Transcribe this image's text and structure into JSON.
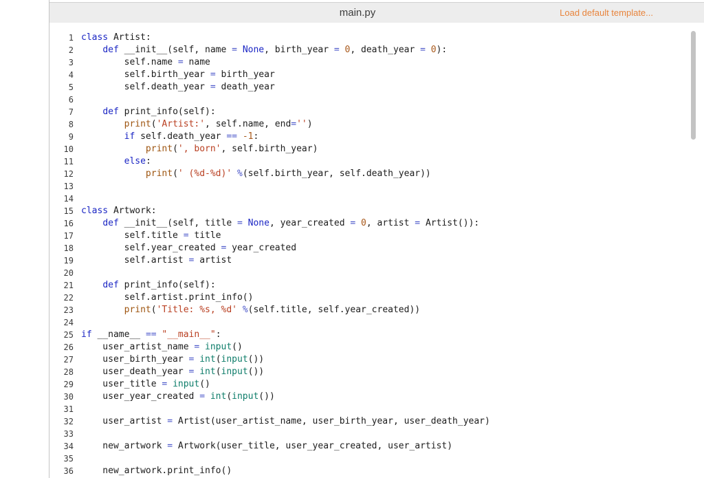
{
  "colors": {
    "accent": "#e8843c",
    "topbar_bg": "#ededed",
    "topbar_border": "#d2d2d2",
    "panel_border": "#c4c4c4",
    "filename": "#3c3c3c",
    "linenum": "#3a3a3a",
    "scrollbar": "#c3c3c3"
  },
  "header": {
    "filename": "main.py",
    "load_template_label": "Load default template..."
  },
  "editor": {
    "syntax_colors": {
      "kw": "#1b26c4",
      "atom": "#1b26c4",
      "op": "#4955c9",
      "num": "#a8581a",
      "str": "#b93f21",
      "builtin": "#9e5510",
      "func": "#0e7d6a",
      "plain": "#1c1c1c"
    },
    "lines": [
      {
        "num": 1,
        "tokens": [
          [
            "kw",
            "class"
          ],
          [
            "plain",
            " Artist:"
          ]
        ]
      },
      {
        "num": 2,
        "tokens": [
          [
            "plain",
            "    "
          ],
          [
            "kw",
            "def"
          ],
          [
            "plain",
            " __init__(self, name "
          ],
          [
            "op",
            "="
          ],
          [
            "plain",
            " "
          ],
          [
            "atom",
            "None"
          ],
          [
            "plain",
            ", birth_year "
          ],
          [
            "op",
            "="
          ],
          [
            "plain",
            " "
          ],
          [
            "num",
            "0"
          ],
          [
            "plain",
            ", death_year "
          ],
          [
            "op",
            "="
          ],
          [
            "plain",
            " "
          ],
          [
            "num",
            "0"
          ],
          [
            "plain",
            "):"
          ]
        ]
      },
      {
        "num": 3,
        "tokens": [
          [
            "plain",
            "        self.name "
          ],
          [
            "op",
            "="
          ],
          [
            "plain",
            " name"
          ]
        ]
      },
      {
        "num": 4,
        "tokens": [
          [
            "plain",
            "        self.birth_year "
          ],
          [
            "op",
            "="
          ],
          [
            "plain",
            " birth_year"
          ]
        ]
      },
      {
        "num": 5,
        "tokens": [
          [
            "plain",
            "        self.death_year "
          ],
          [
            "op",
            "="
          ],
          [
            "plain",
            " death_year"
          ]
        ]
      },
      {
        "num": 6,
        "tokens": []
      },
      {
        "num": 7,
        "tokens": [
          [
            "plain",
            "    "
          ],
          [
            "kw",
            "def"
          ],
          [
            "plain",
            " print_info(self):"
          ]
        ]
      },
      {
        "num": 8,
        "tokens": [
          [
            "plain",
            "        "
          ],
          [
            "builtin",
            "print"
          ],
          [
            "plain",
            "("
          ],
          [
            "str",
            "'Artist:'"
          ],
          [
            "plain",
            ", self.name, end"
          ],
          [
            "op",
            "="
          ],
          [
            "str",
            "''"
          ],
          [
            "plain",
            ")"
          ]
        ]
      },
      {
        "num": 9,
        "tokens": [
          [
            "plain",
            "        "
          ],
          [
            "kw",
            "if"
          ],
          [
            "plain",
            " self.death_year "
          ],
          [
            "op",
            "=="
          ],
          [
            "plain",
            " "
          ],
          [
            "num",
            "-1"
          ],
          [
            "plain",
            ":"
          ]
        ]
      },
      {
        "num": 10,
        "tokens": [
          [
            "plain",
            "            "
          ],
          [
            "builtin",
            "print"
          ],
          [
            "plain",
            "("
          ],
          [
            "str",
            "', born'"
          ],
          [
            "plain",
            ", self.birth_year)"
          ]
        ]
      },
      {
        "num": 11,
        "tokens": [
          [
            "plain",
            "        "
          ],
          [
            "kw",
            "else"
          ],
          [
            "plain",
            ":"
          ]
        ]
      },
      {
        "num": 12,
        "tokens": [
          [
            "plain",
            "            "
          ],
          [
            "builtin",
            "print"
          ],
          [
            "plain",
            "("
          ],
          [
            "str",
            "' (%d-%d)'"
          ],
          [
            "plain",
            " "
          ],
          [
            "op",
            "%"
          ],
          [
            "plain",
            "(self.birth_year, self.death_year))"
          ]
        ]
      },
      {
        "num": 13,
        "tokens": []
      },
      {
        "num": 14,
        "tokens": []
      },
      {
        "num": 15,
        "tokens": [
          [
            "kw",
            "class"
          ],
          [
            "plain",
            " Artwork:"
          ]
        ]
      },
      {
        "num": 16,
        "tokens": [
          [
            "plain",
            "    "
          ],
          [
            "kw",
            "def"
          ],
          [
            "plain",
            " __init__(self, title "
          ],
          [
            "op",
            "="
          ],
          [
            "plain",
            " "
          ],
          [
            "atom",
            "None"
          ],
          [
            "plain",
            ", year_created "
          ],
          [
            "op",
            "="
          ],
          [
            "plain",
            " "
          ],
          [
            "num",
            "0"
          ],
          [
            "plain",
            ", artist "
          ],
          [
            "op",
            "="
          ],
          [
            "plain",
            " Artist()):"
          ]
        ]
      },
      {
        "num": 17,
        "tokens": [
          [
            "plain",
            "        self.title "
          ],
          [
            "op",
            "="
          ],
          [
            "plain",
            " title"
          ]
        ]
      },
      {
        "num": 18,
        "tokens": [
          [
            "plain",
            "        self.year_created "
          ],
          [
            "op",
            "="
          ],
          [
            "plain",
            " year_created"
          ]
        ]
      },
      {
        "num": 19,
        "tokens": [
          [
            "plain",
            "        self.artist "
          ],
          [
            "op",
            "="
          ],
          [
            "plain",
            " artist"
          ]
        ]
      },
      {
        "num": 20,
        "tokens": []
      },
      {
        "num": 21,
        "tokens": [
          [
            "plain",
            "    "
          ],
          [
            "kw",
            "def"
          ],
          [
            "plain",
            " print_info(self):"
          ]
        ]
      },
      {
        "num": 22,
        "tokens": [
          [
            "plain",
            "        self.artist.print_info()"
          ]
        ]
      },
      {
        "num": 23,
        "tokens": [
          [
            "plain",
            "        "
          ],
          [
            "builtin",
            "print"
          ],
          [
            "plain",
            "("
          ],
          [
            "str",
            "'Title: %s, %d'"
          ],
          [
            "plain",
            " "
          ],
          [
            "op",
            "%"
          ],
          [
            "plain",
            "(self.title, self.year_created))"
          ]
        ]
      },
      {
        "num": 24,
        "tokens": []
      },
      {
        "num": 25,
        "tokens": [
          [
            "kw",
            "if"
          ],
          [
            "plain",
            " __name__ "
          ],
          [
            "op",
            "=="
          ],
          [
            "plain",
            " "
          ],
          [
            "str",
            "\"__main__\""
          ],
          [
            "plain",
            ":"
          ]
        ]
      },
      {
        "num": 26,
        "tokens": [
          [
            "plain",
            "    user_artist_name "
          ],
          [
            "op",
            "="
          ],
          [
            "plain",
            " "
          ],
          [
            "func",
            "input"
          ],
          [
            "plain",
            "()"
          ]
        ]
      },
      {
        "num": 27,
        "tokens": [
          [
            "plain",
            "    user_birth_year "
          ],
          [
            "op",
            "="
          ],
          [
            "plain",
            " "
          ],
          [
            "func",
            "int"
          ],
          [
            "plain",
            "("
          ],
          [
            "func",
            "input"
          ],
          [
            "plain",
            "())"
          ]
        ]
      },
      {
        "num": 28,
        "tokens": [
          [
            "plain",
            "    user_death_year "
          ],
          [
            "op",
            "="
          ],
          [
            "plain",
            " "
          ],
          [
            "func",
            "int"
          ],
          [
            "plain",
            "("
          ],
          [
            "func",
            "input"
          ],
          [
            "plain",
            "())"
          ]
        ]
      },
      {
        "num": 29,
        "tokens": [
          [
            "plain",
            "    user_title "
          ],
          [
            "op",
            "="
          ],
          [
            "plain",
            " "
          ],
          [
            "func",
            "input"
          ],
          [
            "plain",
            "()"
          ]
        ]
      },
      {
        "num": 30,
        "tokens": [
          [
            "plain",
            "    user_year_created "
          ],
          [
            "op",
            "="
          ],
          [
            "plain",
            " "
          ],
          [
            "func",
            "int"
          ],
          [
            "plain",
            "("
          ],
          [
            "func",
            "input"
          ],
          [
            "plain",
            "())"
          ]
        ]
      },
      {
        "num": 31,
        "tokens": []
      },
      {
        "num": 32,
        "tokens": [
          [
            "plain",
            "    user_artist "
          ],
          [
            "op",
            "="
          ],
          [
            "plain",
            " Artist(user_artist_name, user_birth_year, user_death_year)"
          ]
        ]
      },
      {
        "num": 33,
        "tokens": []
      },
      {
        "num": 34,
        "tokens": [
          [
            "plain",
            "    new_artwork "
          ],
          [
            "op",
            "="
          ],
          [
            "plain",
            " Artwork(user_title, user_year_created, user_artist)"
          ]
        ]
      },
      {
        "num": 35,
        "tokens": []
      },
      {
        "num": 36,
        "tokens": [
          [
            "plain",
            "    new_artwork.print_info()"
          ]
        ]
      }
    ]
  }
}
